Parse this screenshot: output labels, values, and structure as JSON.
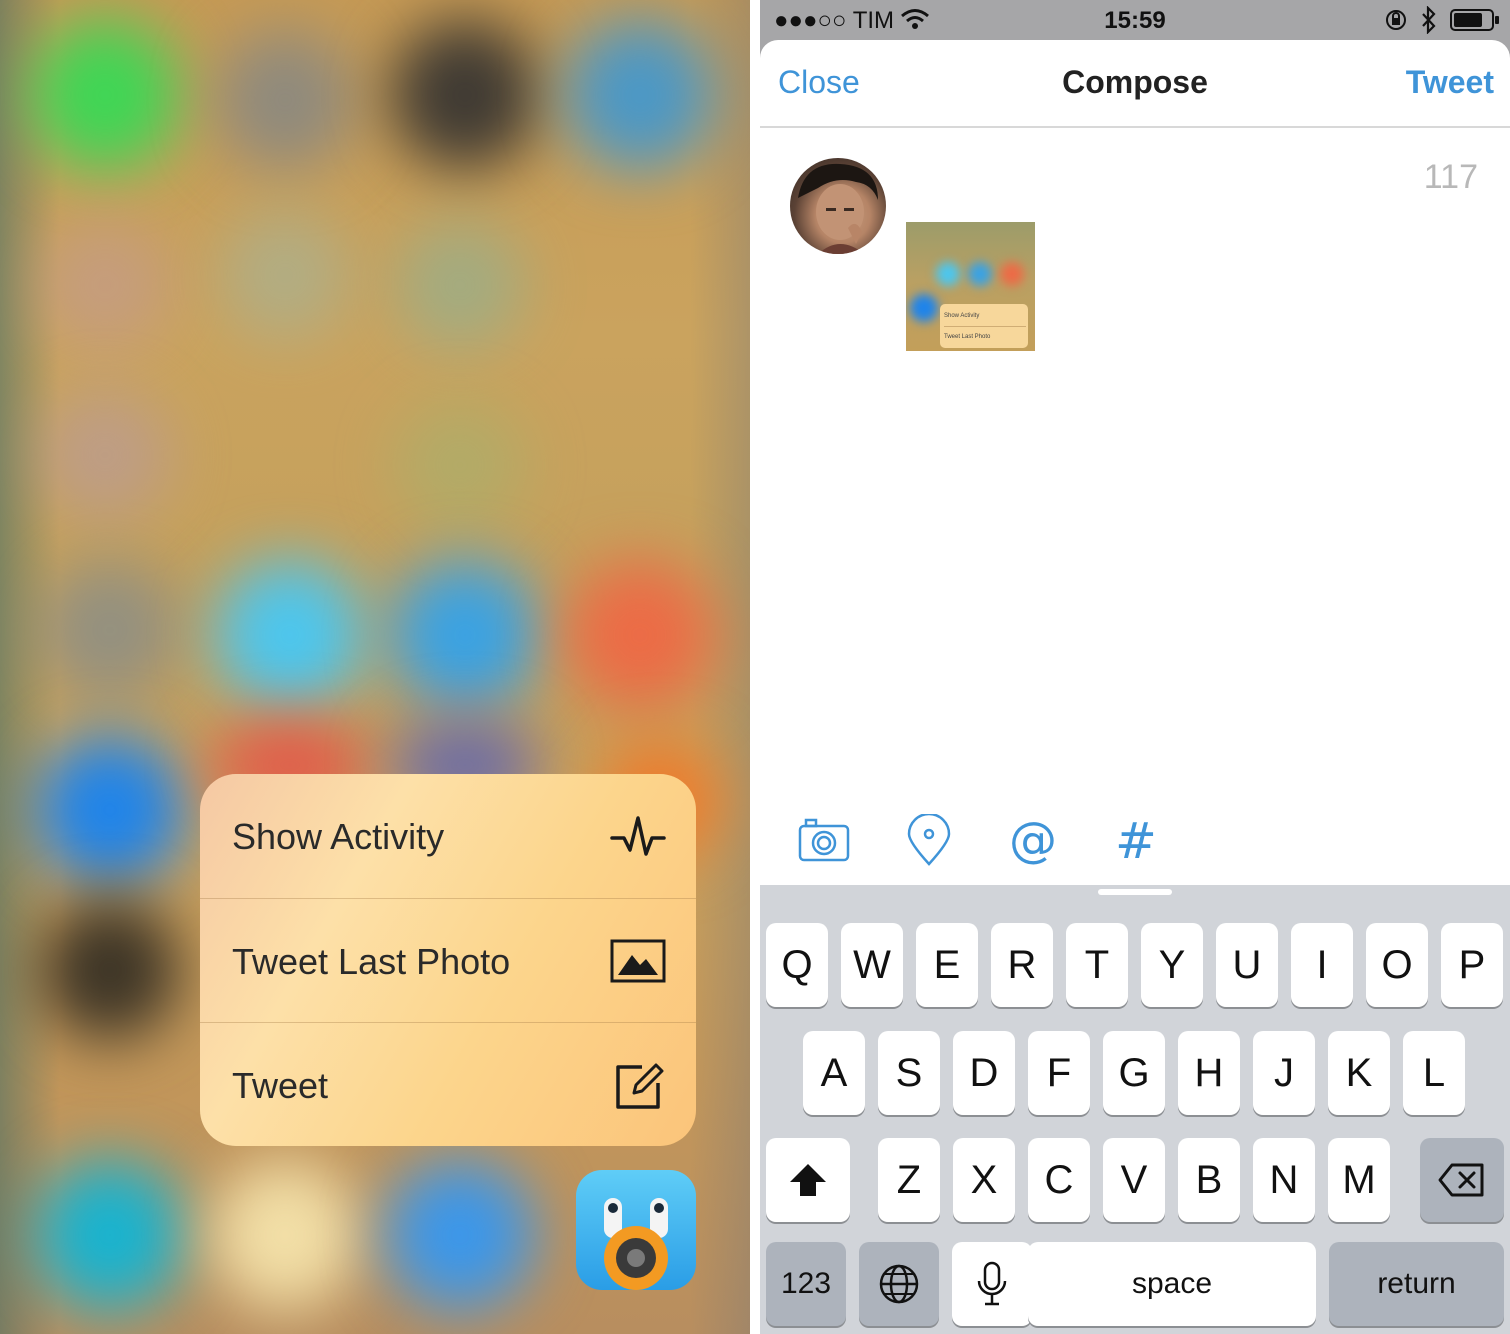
{
  "left_panel": {
    "quick_actions": [
      {
        "label": "Show Activity",
        "icon": "activity-pulse-icon"
      },
      {
        "label": "Tweet Last Photo",
        "icon": "photo-icon"
      },
      {
        "label": "Tweet",
        "icon": "compose-icon"
      }
    ],
    "app_icon": "tweetbot-app-icon"
  },
  "status_bar": {
    "carrier": "●●●○○ TIM",
    "time": "15:59",
    "icons": [
      "wifi-icon",
      "orientation-lock-icon",
      "bluetooth-icon",
      "battery-icon"
    ]
  },
  "compose": {
    "close_label": "Close",
    "title": "Compose",
    "tweet_label": "Tweet",
    "char_count": "117",
    "attachment_thumb_items": [
      "Show Activity",
      "Tweet Last Photo"
    ]
  },
  "toolbar": {
    "icons": [
      "camera-icon",
      "location-pin-icon",
      "mention-icon",
      "hashtag-icon"
    ]
  },
  "keyboard": {
    "row1": [
      "Q",
      "W",
      "E",
      "R",
      "T",
      "Y",
      "U",
      "I",
      "O",
      "P"
    ],
    "row2": [
      "A",
      "S",
      "D",
      "F",
      "G",
      "H",
      "J",
      "K",
      "L"
    ],
    "row3": [
      "Z",
      "X",
      "C",
      "V",
      "B",
      "N",
      "M"
    ],
    "numbers_label": "123",
    "space_label": "space",
    "return_label": "return"
  },
  "colors": {
    "accent": "#3f94d8",
    "menu_bg": "#fcd58c",
    "keyboard_bg": "#d1d4d9"
  }
}
